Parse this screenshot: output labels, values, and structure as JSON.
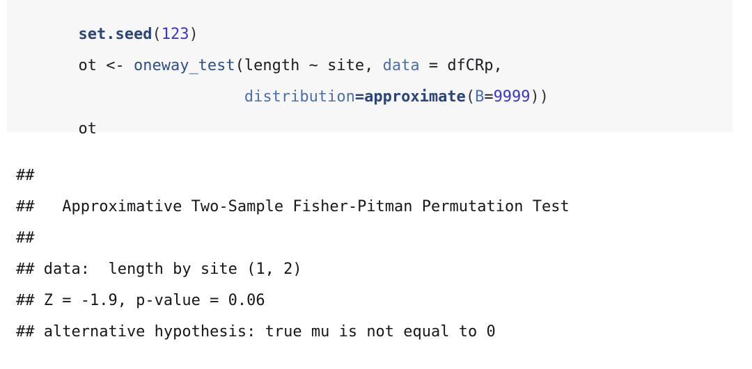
{
  "document": {
    "type": "r-markdown-console-transcript",
    "background_color": "#ffffff"
  },
  "code_block": {
    "background_color": "#f7f7f7",
    "language": "R",
    "colors": {
      "function_bold": "#29457a",
      "function": "#2d4f8e",
      "number": "#3a35cf",
      "argument": "#4a6fae",
      "plain": "#1c1c22"
    },
    "lines": [
      {
        "id": "line-1",
        "tokens": [
          {
            "text": "set.seed",
            "type": "tok-fn"
          },
          {
            "text": "(",
            "type": "tok-punct"
          },
          {
            "text": "123",
            "type": "tok-num"
          },
          {
            "text": ")",
            "type": "tok-punct"
          }
        ]
      },
      {
        "id": "line-2",
        "tokens": [
          {
            "text": "ot <- ",
            "type": "tok-plain"
          },
          {
            "text": "oneway_test",
            "type": "tok-fn2"
          },
          {
            "text": "(length ~ site, ",
            "type": "tok-plain"
          },
          {
            "text": "data",
            "type": "tok-arg"
          },
          {
            "text": " = dfCRp,",
            "type": "tok-plain"
          }
        ]
      },
      {
        "id": "line-3",
        "tokens": [
          {
            "text": "                  ",
            "type": "tok-plain"
          },
          {
            "text": "distribution",
            "type": "tok-arg"
          },
          {
            "text": "=",
            "type": "tok-fn"
          },
          {
            "text": "approximate",
            "type": "tok-fn"
          },
          {
            "text": "(",
            "type": "tok-punct"
          },
          {
            "text": "B",
            "type": "tok-arg"
          },
          {
            "text": "=",
            "type": "tok-plain"
          },
          {
            "text": "9999",
            "type": "tok-num"
          },
          {
            "text": "))",
            "type": "tok-punct"
          }
        ]
      },
      {
        "id": "line-4",
        "tokens": [
          {
            "text": "ot",
            "type": "tok-plain"
          }
        ]
      }
    ],
    "plain_text": [
      "set.seed(123)",
      "ot <- oneway_test(length ~ site, data = dfCRp,",
      "                  distribution=approximate(B=9999))",
      "ot"
    ]
  },
  "console_output": {
    "text_color": "#17171b",
    "lines": [
      "## ",
      "##   Approximative Two-Sample Fisher-Pitman Permutation Test",
      "## ",
      "## data:  length by site (1, 2)",
      "## Z = -1.9, p-value = 0.06",
      "## alternative hypothesis: true mu is not equal to 0"
    ],
    "test_name": "Approximative Two-Sample Fisher-Pitman Permutation Test",
    "data_description": "length by site (1, 2)",
    "statistic_label": "Z",
    "statistic_value": "-1.9",
    "p_value_label": "p-value",
    "p_value": "0.06",
    "alternative_hypothesis": "true mu is not equal to 0"
  }
}
